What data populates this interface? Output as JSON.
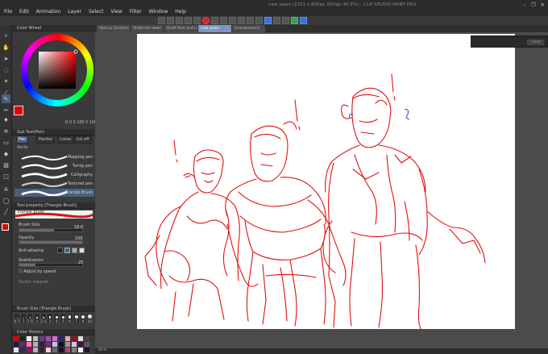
{
  "menu": [
    "File",
    "Edit",
    "Animation",
    "Layer",
    "Select",
    "View",
    "Filter",
    "Window",
    "Help"
  ],
  "window_title": "new years (1101 x 800px 300dpi 46.8%)  - CLIP STUDIO PAINT PRO",
  "window_controls": [
    "–",
    "❐",
    "✕"
  ],
  "doc_tabs": [
    "Vast au Sinderrz",
    "Strike me down",
    "Draft Rain and Lir",
    "new years",
    "Grandemeer1"
  ],
  "color_wheel": {
    "title": "Color Wheel",
    "readout_h": "0",
    "readout_s": "100",
    "readout_v": "100",
    "selected_color": "#e00000"
  },
  "sub_tool": {
    "title": "Sub Tool(Pen)",
    "tabs": [
      "Pen",
      "Marker",
      "Loose",
      "Ink eff"
    ]
  },
  "brushes": [
    {
      "name": "Mapping pen"
    },
    {
      "name": "Turnip pen"
    },
    {
      "name": "Calligraphy"
    },
    {
      "name": "Textured pen"
    },
    {
      "name": "Triangle Brush"
    }
  ],
  "tool_property": {
    "title": "Tool property [Triangle Brush]",
    "brush_preview_label": "Triangle Brush",
    "brush_size_label": "Brush Size",
    "brush_size_value": "18.0",
    "opacity_label": "Opacity",
    "opacity_value": "100",
    "anti_aliasing_label": "Anti-aliasing",
    "stabilization_label": "Stabilization",
    "stabilization_value": "25",
    "adjust_speed_label": "Adjust by speed",
    "vector_magnet_label": "Vector magnet"
  },
  "brush_size_panel": {
    "title": "Brush Size (Triangle Brush)",
    "sizes": [
      "0.7",
      "1",
      "1.5",
      "2",
      "2.5",
      "3",
      "4",
      "5",
      "6",
      "7",
      "8",
      "10"
    ]
  },
  "color_history": {
    "title": "Color History"
  },
  "float_button": "Close",
  "status": {
    "zoom": "46.8"
  },
  "colors": {
    "accent": "#4a5f80",
    "sketch_red": "#e01010",
    "canvas": "#ffffff",
    "bg": "#4b4b4b"
  },
  "icons": [
    "zoom-icon",
    "move-icon",
    "operation-icon",
    "lasso-icon",
    "magic-wand-icon",
    "eyedropper-icon",
    "pen-icon",
    "pencil-icon",
    "brush-icon",
    "airbrush-icon",
    "eraser-icon",
    "fill-icon",
    "gradient-icon",
    "figure-icon",
    "text-icon",
    "balloon-icon",
    "ruler-icon",
    "main-color-swatch"
  ]
}
